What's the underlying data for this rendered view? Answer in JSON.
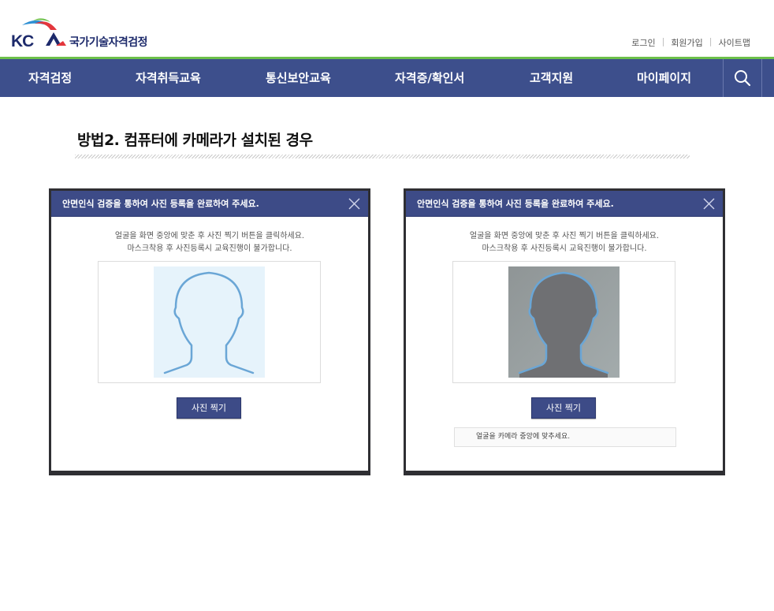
{
  "header": {
    "logo_text": "국가기술자격검정",
    "logo_mark": "KCA",
    "util_links": [
      "로그인",
      "회원가입",
      "사이트맵"
    ]
  },
  "nav": {
    "items": [
      "자격검정",
      "자격취득교육",
      "통신보안교육",
      "자격증/확인서",
      "고객지원",
      "마이페이지"
    ],
    "search_icon": "search-icon"
  },
  "content": {
    "section_title": "방법2. 컴퓨터에 카메라가 설치된 경우"
  },
  "dialogs": [
    {
      "title": "안면인식 검증을 통하여 사진 등록을 완료하여 주세요.",
      "message_line1": "얼굴을 화면 중앙에 맞춘 후 사진 찍기 버튼을 클릭하세요.",
      "message_line2": "마스크착용 후 사진등록시 교육진행이 불가합니다.",
      "button_label": "사진 찍기",
      "state": "placeholder-silhouette"
    },
    {
      "title": "안면인식 검증을 통하여 사진 등록을 완료하여 주세요.",
      "message_line1": "얼굴을 화면 중앙에 맞춘 후 사진 찍기 버튼을 클릭하세요.",
      "message_line2": "마스크착용 후 사진등록시 교육진행이 불가합니다.",
      "button_label": "사진 찍기",
      "notice": "얼굴을 카메라 중앙에 맞추세요.",
      "state": "camera-preview"
    }
  ],
  "colors": {
    "nav_bg": "#3d4f8c",
    "accent_green": "#6cc04a",
    "dialog_header": "#3d4b87",
    "silhouette_stroke": "#6aa6d6"
  }
}
